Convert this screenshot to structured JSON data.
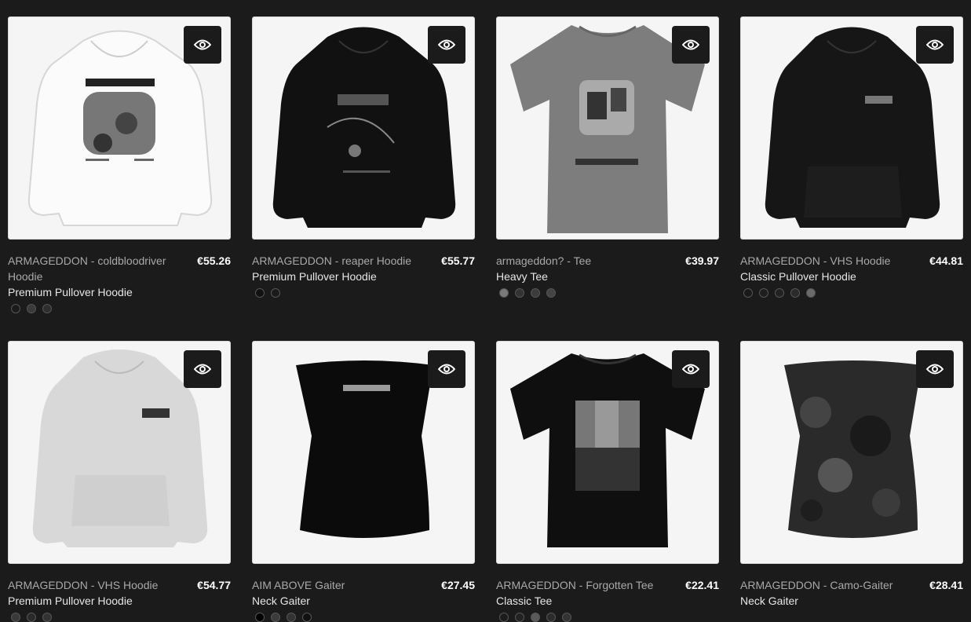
{
  "products": [
    {
      "title": "ARMAGEDDON - coldbloodriver Hoodie",
      "price": "€55.26",
      "type": "Premium Pullover Hoodie",
      "image_icon": "white-hoodie-graphic",
      "swatches": [
        "#1b1b1b",
        "#3a3a3a",
        "#2e2e2e"
      ]
    },
    {
      "title": "ARMAGEDDON - reaper Hoodie",
      "price": "€55.77",
      "type": "Premium Pullover Hoodie",
      "image_icon": "black-hoodie-graphic",
      "swatches": [
        "#111111",
        "#1b1b1b"
      ]
    },
    {
      "title": "armageddon? - Tee",
      "price": "€39.97",
      "type": "Heavy Tee",
      "image_icon": "grey-tee-graphic",
      "swatches": [
        "#7a7a7a",
        "#333333",
        "#3c3c3c",
        "#444444"
      ]
    },
    {
      "title": "ARMAGEDDON - VHS Hoodie",
      "price": "€44.81",
      "type": "Classic Pullover Hoodie",
      "image_icon": "black-hoodie-graphic",
      "swatches": [
        "#1a1a1a",
        "#1e1e1e",
        "#222222",
        "#2a2a2a",
        "#6a6a6a"
      ]
    },
    {
      "title": "ARMAGEDDON - VHS Hoodie",
      "price": "€54.77",
      "type": "Premium Pullover Hoodie",
      "image_icon": "grey-hoodie-graphic",
      "swatches": [
        "#3a3a3a",
        "#2a2a2a",
        "#333333"
      ]
    },
    {
      "title": "AIM ABOVE Gaiter",
      "price": "€27.45",
      "type": "Neck Gaiter",
      "image_icon": "black-gaiter-graphic",
      "swatches": [
        "#000000",
        "#3b3b3b",
        "#333333",
        "#111111"
      ]
    },
    {
      "title": "ARMAGEDDON - Forgotten Tee",
      "price": "€22.41",
      "type": "Classic Tee",
      "image_icon": "black-tee-graphic",
      "swatches": [
        "#1c1c1c",
        "#222222",
        "#5a5a5a",
        "#2c2c2c",
        "#333333"
      ]
    },
    {
      "title": "ARMAGEDDON - Camo-Gaiter",
      "price": "€28.41",
      "type": "Neck Gaiter",
      "image_icon": "camo-gaiter-graphic",
      "swatches": []
    }
  ]
}
